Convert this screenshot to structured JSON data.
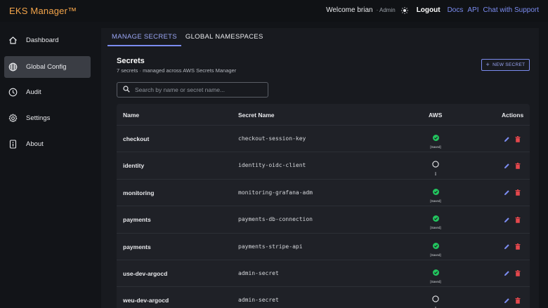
{
  "header": {
    "brand": "EKS Manager™",
    "welcome": "Welcome brian",
    "role": "· Admin",
    "logout": "Logout",
    "links": [
      "Docs",
      "API",
      "Chat with Support"
    ]
  },
  "sidebar": {
    "items": [
      {
        "label": "Dashboard",
        "icon": "home-icon"
      },
      {
        "label": "Global Config",
        "icon": "globe-icon",
        "active": true
      },
      {
        "label": "Audit",
        "icon": "clock-icon"
      },
      {
        "label": "Settings",
        "icon": "gear-icon"
      },
      {
        "label": "About",
        "icon": "info-icon"
      }
    ]
  },
  "tabs": [
    {
      "label": "MANAGE SECRETS",
      "active": true
    },
    {
      "label": "GLOBAL NAMESPACES",
      "active": false
    }
  ],
  "secrets": {
    "title": "Secrets",
    "subtitle": "7 secrets · managed across AWS Secrets Manager",
    "new_button": "NEW SECRET",
    "search_placeholder": "Search by name or secret name...",
    "columns": {
      "name": "Name",
      "secret_name": "Secret Name",
      "aws": "AWS",
      "actions": "Actions"
    },
    "rows": [
      {
        "name": "checkout",
        "secret_name": "checkout-session-key",
        "aws_saved": true,
        "aws_label": "[Saved]"
      },
      {
        "name": "identity",
        "secret_name": "identity-oidc-client",
        "aws_saved": false,
        "aws_label": "[]"
      },
      {
        "name": "monitoring",
        "secret_name": "monitoring-grafana-adm",
        "aws_saved": true,
        "aws_label": "[Saved]"
      },
      {
        "name": "payments",
        "secret_name": "payments-db-connection",
        "aws_saved": true,
        "aws_label": "[Saved]"
      },
      {
        "name": "payments",
        "secret_name": "payments-stripe-api",
        "aws_saved": true,
        "aws_label": "[Saved]"
      },
      {
        "name": "use-dev-argocd",
        "secret_name": "admin-secret",
        "aws_saved": true,
        "aws_label": "[Saved]"
      },
      {
        "name": "weu-dev-argocd",
        "secret_name": "admin-secret",
        "aws_saved": false,
        "aws_label": "[]"
      }
    ]
  },
  "colors": {
    "accent": "#7b8cf0",
    "brand": "#f3a44a",
    "saved": "#22c55e",
    "delete": "#e5484d"
  }
}
